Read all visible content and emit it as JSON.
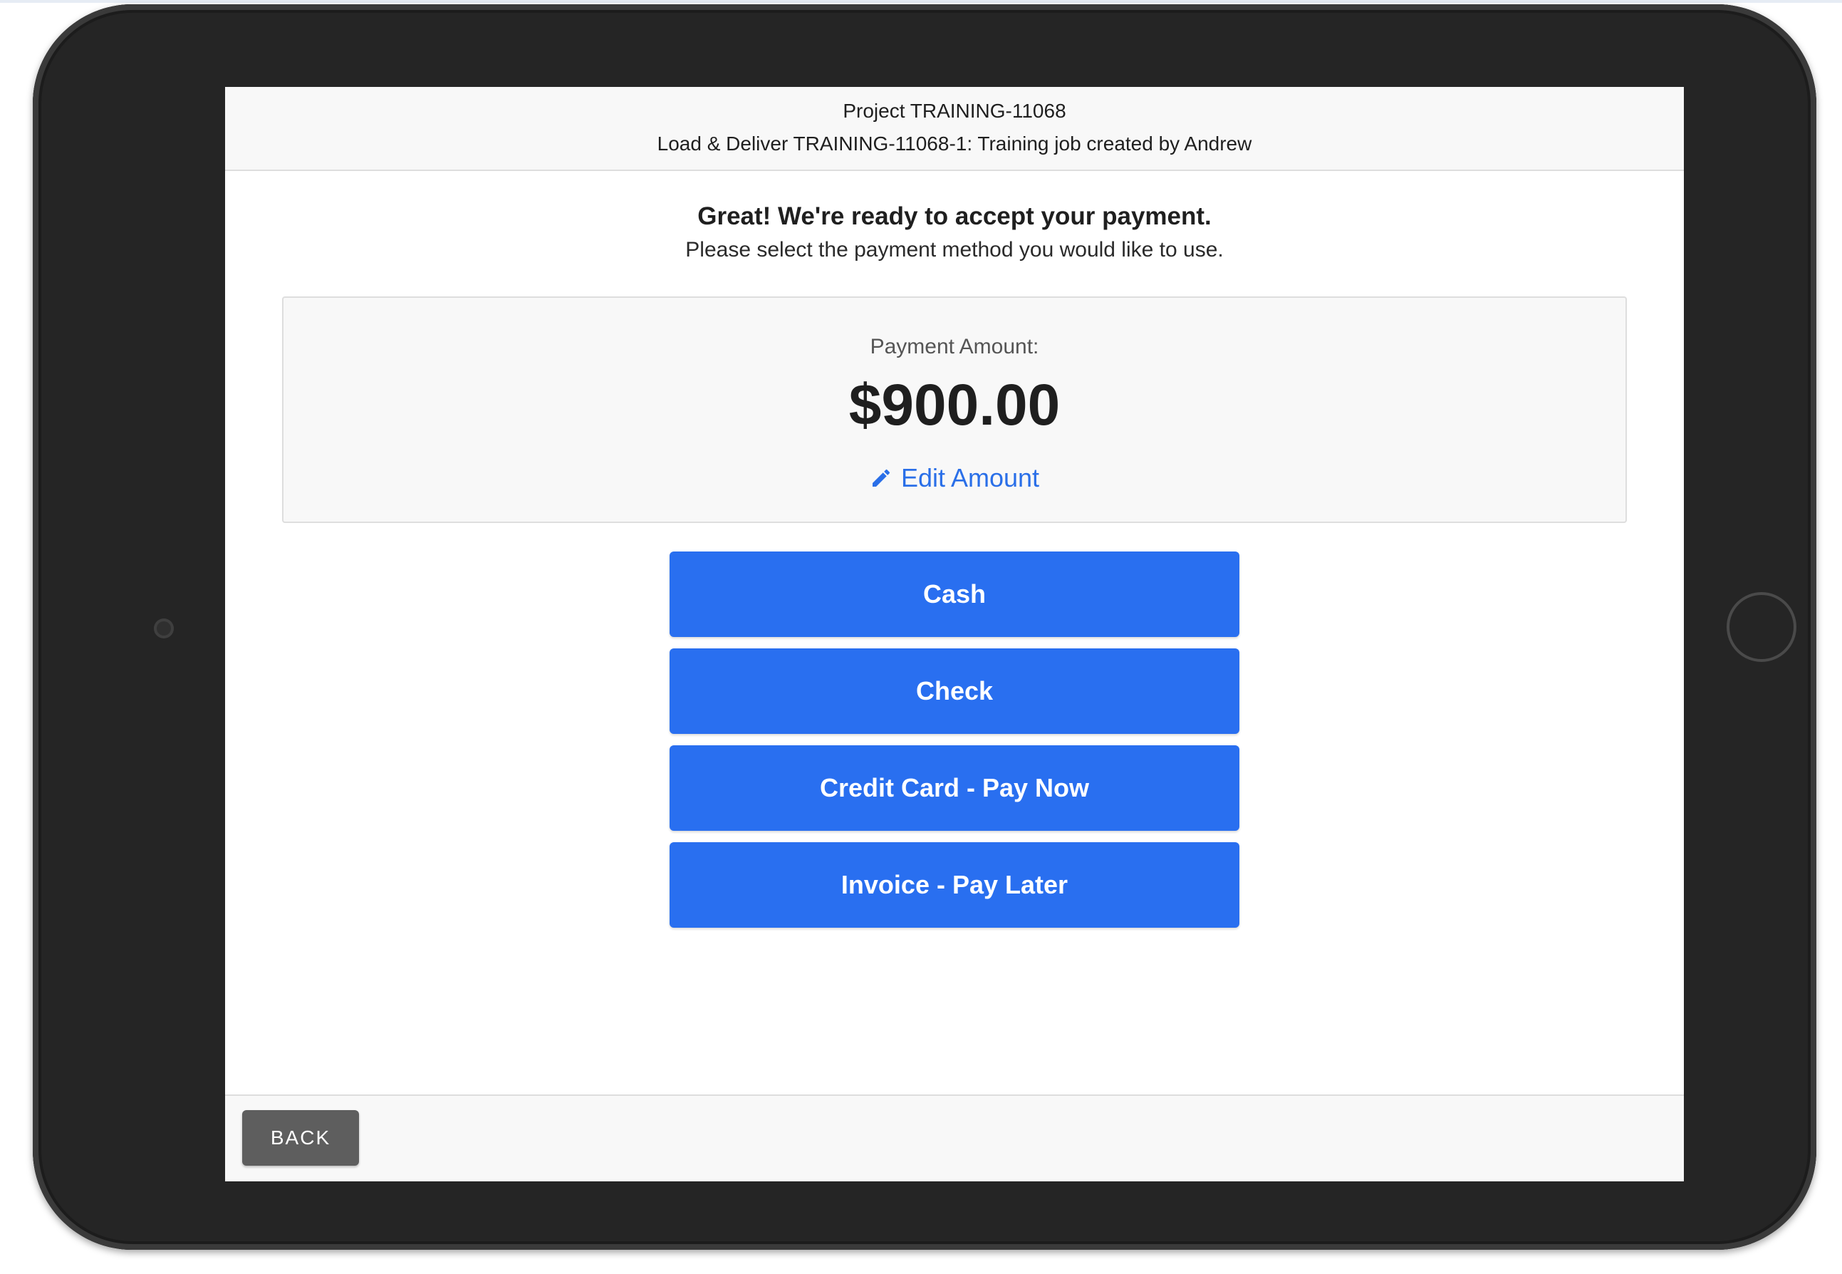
{
  "header": {
    "project": "Project TRAINING-11068",
    "job": "Load & Deliver TRAINING-11068-1: Training job created by Andrew"
  },
  "intro": {
    "title": "Great! We're ready to accept your payment.",
    "subtitle": "Please select the payment method you would like to use."
  },
  "payment": {
    "label": "Payment Amount:",
    "amount": "$900.00",
    "edit_label": "Edit Amount",
    "edit_icon": "pencil-icon"
  },
  "methods": [
    {
      "label": "Cash"
    },
    {
      "label": "Check"
    },
    {
      "label": "Credit Card - Pay Now"
    },
    {
      "label": "Invoice - Pay Later"
    }
  ],
  "footer": {
    "back_label": "BACK"
  },
  "colors": {
    "accent": "#296ff0",
    "link": "#2a6fe8",
    "back_button": "#5e5e5e",
    "device_frame": "#252525"
  }
}
